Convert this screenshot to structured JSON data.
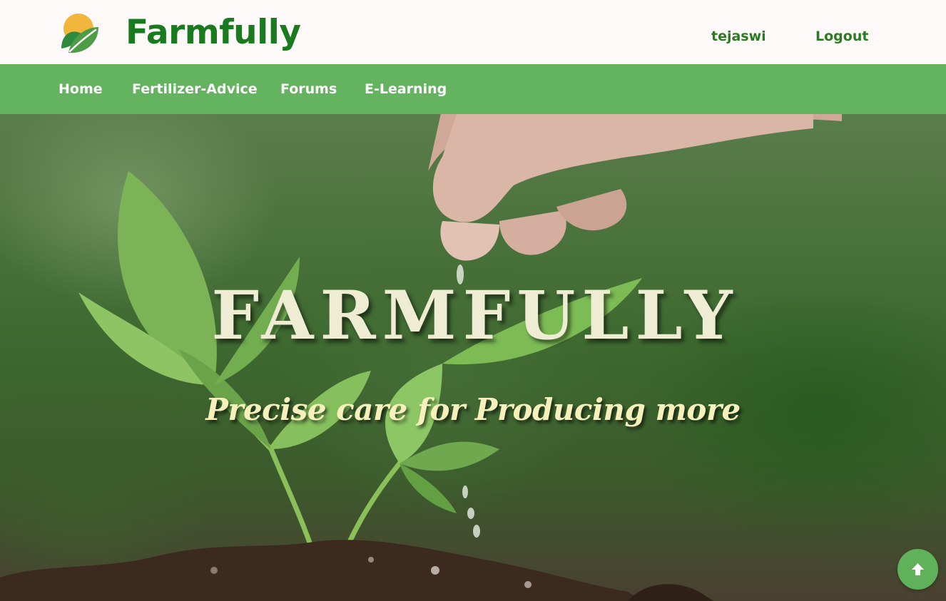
{
  "header": {
    "brand": "Farmfully",
    "username": "tejaswi",
    "logout_label": "Logout"
  },
  "nav": {
    "items": [
      {
        "label": "Home"
      },
      {
        "label": "Fertilizer-Advice"
      },
      {
        "label": "Forums"
      },
      {
        "label": "E-Learning"
      }
    ]
  },
  "hero": {
    "title": "FARMFULLY",
    "tagline": "Precise care for Producing more"
  },
  "icons": {
    "logo": "leaf-sun-logo",
    "scroll_top": "arrow-up-icon"
  },
  "colors": {
    "brand_green": "#1a7a1f",
    "nav_green": "#63b35f",
    "header_bg": "#fdf9f8",
    "hero_title": "#eeecd2",
    "tagline": "#f6f0bc"
  }
}
